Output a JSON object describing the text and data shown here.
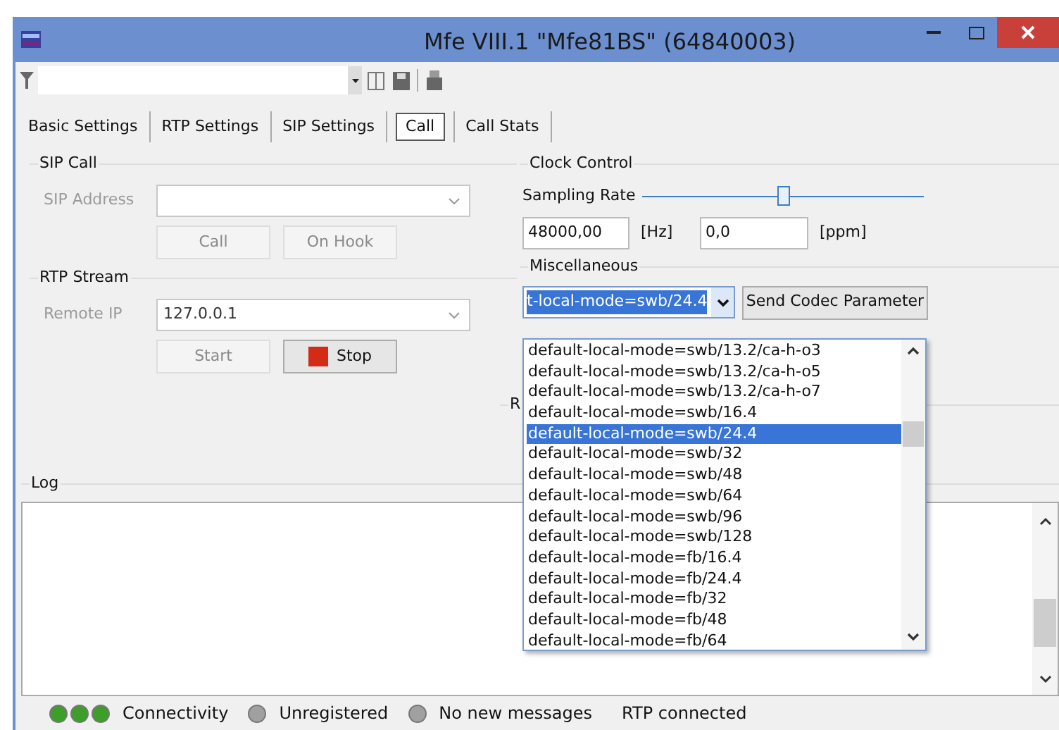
{
  "window": {
    "title": "Mfe VIII.1 \"Mfe81BS\" (64840003)"
  },
  "tabs": [
    {
      "label": "Basic Settings",
      "selected": false
    },
    {
      "label": "RTP Settings",
      "selected": false
    },
    {
      "label": "SIP Settings",
      "selected": false
    },
    {
      "label": "Call",
      "selected": true
    },
    {
      "label": "Call Stats",
      "selected": false
    }
  ],
  "sip_call": {
    "title": "SIP Call",
    "address_label": "SIP Address",
    "disabled": true,
    "buttons": [
      {
        "label": "Call",
        "disabled": true
      },
      {
        "label": "On Hook",
        "disabled": true
      }
    ]
  },
  "rtp_stream": {
    "title": "RTP Stream",
    "ip_label": "Remote IP",
    "ip_value": "127.0.0.1",
    "disabled": true,
    "buttons": [
      {
        "label": "Start",
        "disabled": true,
        "kind": "start"
      },
      {
        "label": "Stop",
        "disabled": false,
        "kind": "stop"
      }
    ]
  },
  "clock_control": {
    "title": "Clock Control",
    "slider_label": "Sampling Rate",
    "level": 0.5,
    "rate_value": "48000,00",
    "rate_unit": "[Hz]",
    "ppm_value": "0,0",
    "ppm_unit": "[ppm]"
  },
  "miscellaneous": {
    "title": "Miscellaneous",
    "combo_value": "t-local-mode=swb/24.4",
    "send_button": "Send Codec Parameter",
    "options": [
      {
        "label": "default-local-mode=swb/13.2/ca-h-o3",
        "selected": false
      },
      {
        "label": "default-local-mode=swb/13.2/ca-h-o5",
        "selected": false
      },
      {
        "label": "default-local-mode=swb/13.2/ca-h-o7",
        "selected": false
      },
      {
        "label": "default-local-mode=swb/16.4",
        "selected": false
      },
      {
        "label": "default-local-mode=swb/24.4",
        "selected": true
      },
      {
        "label": "default-local-mode=swb/32",
        "selected": false
      },
      {
        "label": "default-local-mode=swb/48",
        "selected": false
      },
      {
        "label": "default-local-mode=swb/64",
        "selected": false
      },
      {
        "label": "default-local-mode=swb/96",
        "selected": false
      },
      {
        "label": "default-local-mode=swb/128",
        "selected": false
      },
      {
        "label": "default-local-mode=fb/16.4",
        "selected": false
      },
      {
        "label": "default-local-mode=fb/24.4",
        "selected": false
      },
      {
        "label": "default-local-mode=fb/32",
        "selected": false
      },
      {
        "label": "default-local-mode=fb/48",
        "selected": false
      },
      {
        "label": "default-local-mode=fb/64",
        "selected": false
      }
    ]
  },
  "hidden_group": {
    "title": "R"
  },
  "log": {
    "title": "Log"
  },
  "status_bar": [
    {
      "label": "Connectivity",
      "indicators": [
        {
          "color": "#3e9e2a"
        },
        {
          "color": "#3e9e2a"
        },
        {
          "color": "#3e9e2a"
        }
      ]
    },
    {
      "label": "Unregistered",
      "indicators": [
        {
          "color": "#a0a0a0"
        }
      ]
    },
    {
      "label": "No new messages",
      "indicators": [
        {
          "color": "#a0a0a0"
        }
      ]
    },
    {
      "label": "RTP connected"
    }
  ]
}
